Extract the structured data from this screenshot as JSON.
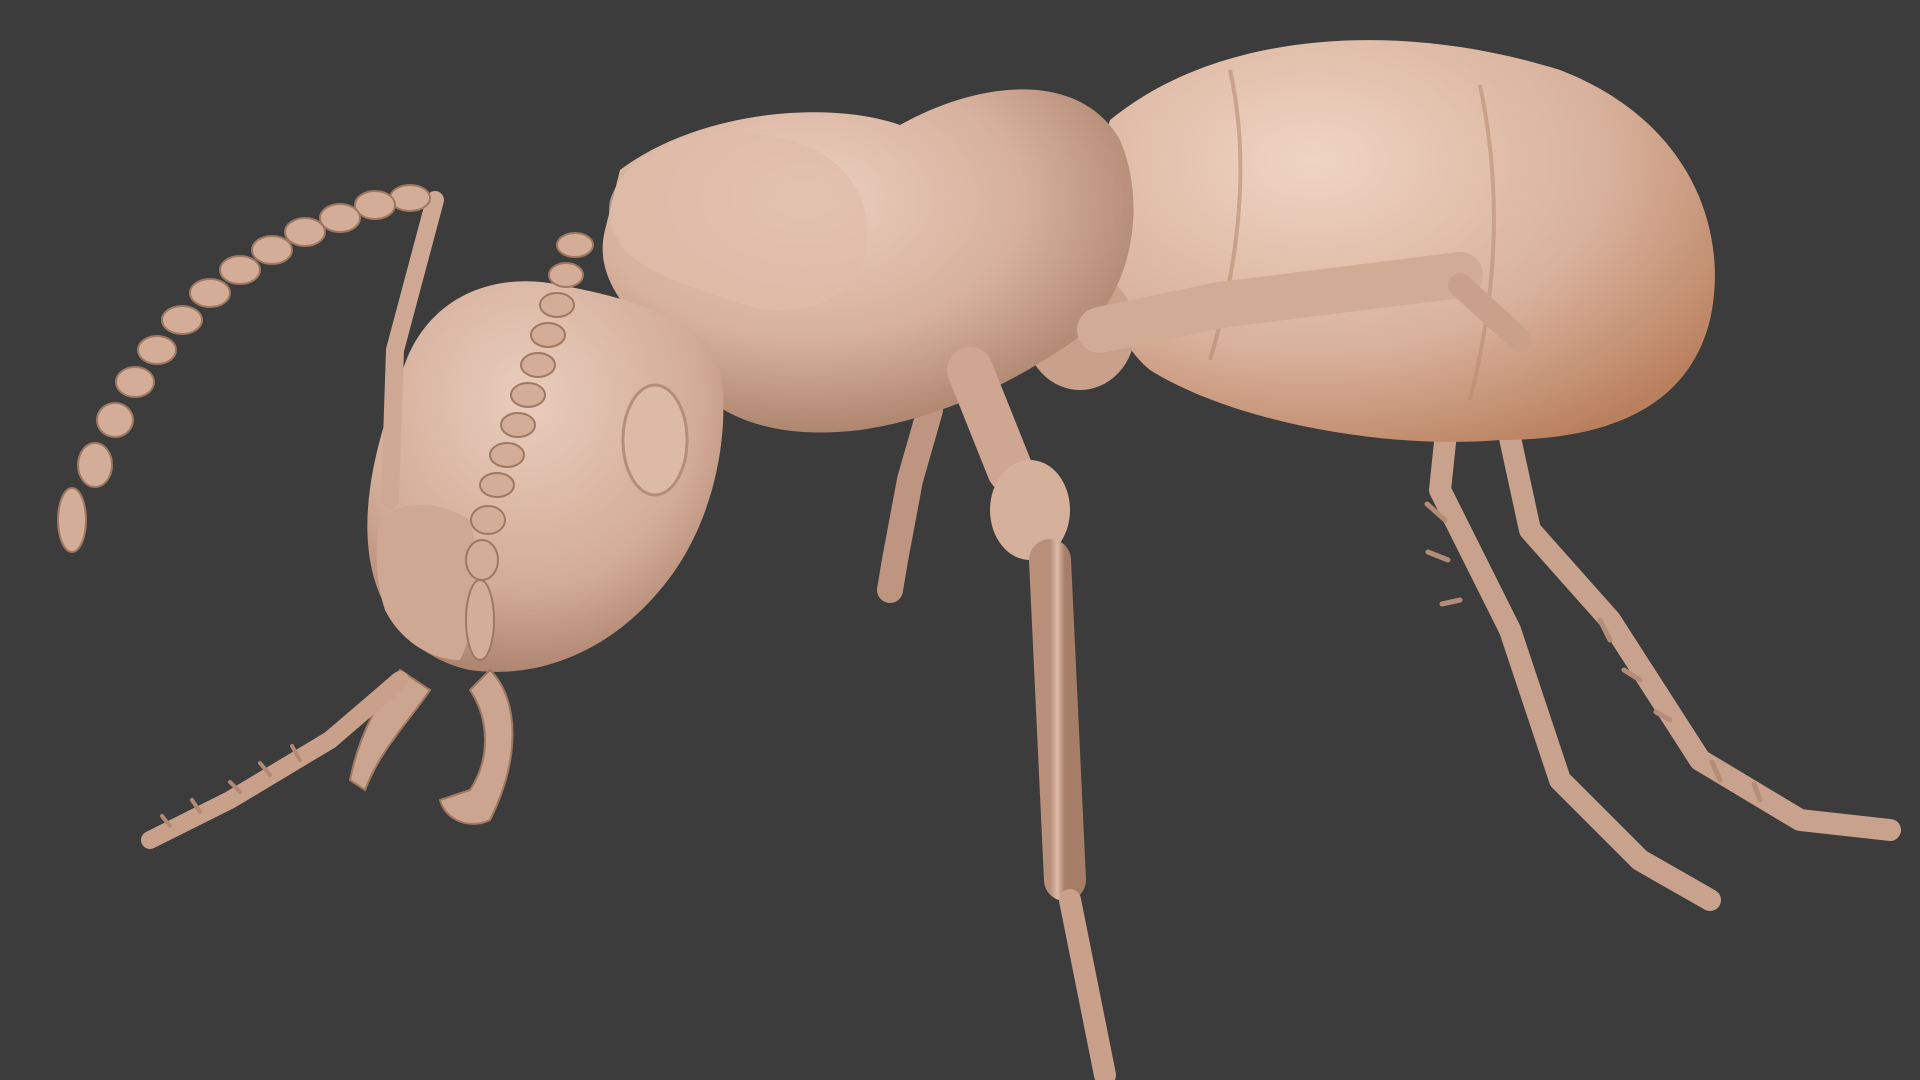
{
  "viewport": {
    "background_color": "#3c3c3c"
  },
  "model": {
    "subject": "ant",
    "material_color": "#d2ab97",
    "highlight_color": "#e6cbbb",
    "shadow_color": "#a07a66"
  }
}
